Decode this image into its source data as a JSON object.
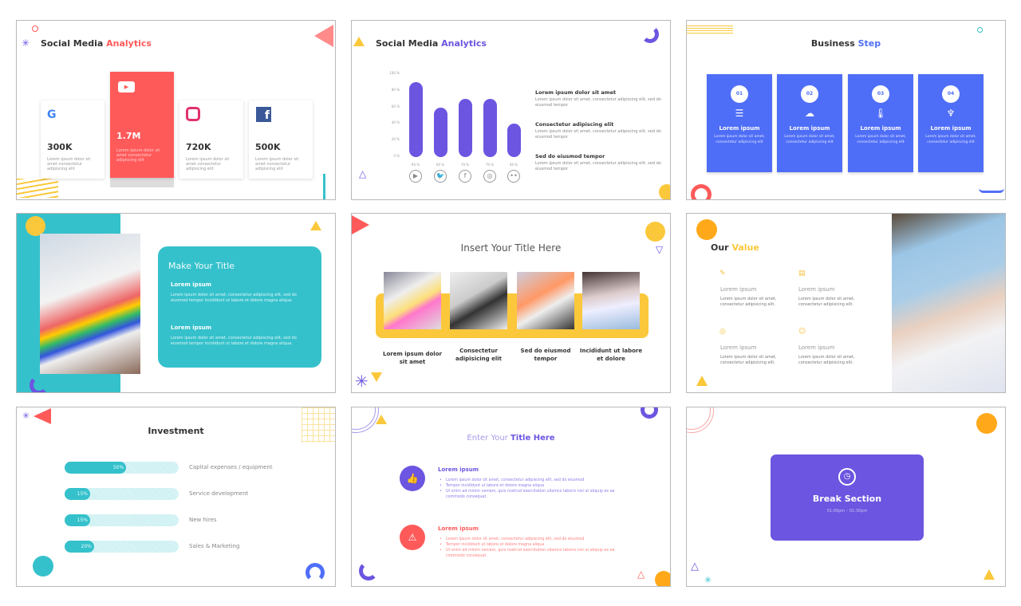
{
  "colors": {
    "red": "#ff5a5a",
    "purple": "#6c55e0",
    "blue": "#4f6ef7",
    "teal": "#35c1cb",
    "yellow": "#fbc83b",
    "orange": "#ffa91a"
  },
  "slides": [
    {
      "title_dark": "Social Media",
      "title_accent": "Analytics",
      "cards": [
        {
          "icon": "google-icon",
          "value": "300K",
          "desc": "Lorem ipsum dolor sit amet consectetur adipiscing elit"
        },
        {
          "icon": "youtube-icon",
          "value": "1.7M",
          "desc": "Lorem ipsum dolor sit amet consectetur adipiscing elit"
        },
        {
          "icon": "instagram-icon",
          "value": "720K",
          "desc": "Lorem ipsum dolor sit amet consectetur adipiscing elit"
        },
        {
          "icon": "facebook-icon",
          "value": "500K",
          "desc": "Lorem ipsum dolor sit amet consectetur adipiscing elit"
        }
      ]
    },
    {
      "title_dark": "Social Media",
      "title_accent": "Analytics",
      "points": [
        {
          "heading": "Lorem ipsum dolor sit amet",
          "desc": "Lorem ipsum dolor sit amet, consectetur adipiscing elit, sed do eiusmod tempor"
        },
        {
          "heading": "Consectetur adipiscing elit",
          "desc": "Lorem ipsum dolor sit amet, consectetur adipiscing elit, sed do eiusmod tempor"
        },
        {
          "heading": "Sed do eiusmod tempor",
          "desc": "Lorem ipsum dolor sit amet, consectetur adipiscing elit, sed do eiusmod tempor"
        }
      ]
    },
    {
      "title_dark": "Business",
      "title_accent": "Step",
      "steps": [
        {
          "num": "01",
          "icon": "server-icon",
          "heading": "Lorem ipsum",
          "desc": "Lorem ipsum dolor sit amet, consectetur adipiscing elit"
        },
        {
          "num": "02",
          "icon": "cloud-network-icon",
          "heading": "Lorem ipsum",
          "desc": "Lorem ipsum dolor sit amet, consectetur adipiscing elit"
        },
        {
          "num": "03",
          "icon": "thermometer-settings-icon",
          "heading": "Lorem ipsum",
          "desc": "Lorem ipsum dolor sit amet, consectetur adipiscing elit"
        },
        {
          "num": "04",
          "icon": "idea-bulbs-icon",
          "heading": "Lorem ipsum",
          "desc": "Lorem ipsum dolor sit amet, consectetur adipiscing elit"
        }
      ]
    },
    {
      "title": "Make Your Title",
      "blocks": [
        {
          "heading": "Lorem ipsum",
          "desc": "Lorem ipsum dolor sit amet, consectetur adipiscing elit, sed do eiusmod tempor incididunt ut labore et dolore magna aliqua."
        },
        {
          "heading": "Lorem ipsum",
          "desc": "Lorem ipsum dolor sit amet, consectetur adipiscing elit, sed do eiusmod tempor incididunt ut labore et dolore magna aliqua."
        }
      ]
    },
    {
      "title": "Insert Your Title Here",
      "captions": [
        "Lorem ipsum dolor sit amet",
        "Consectetur adipisicing elit",
        "Sed do eiusmod tempor",
        "Incididunt ut labore et dolore"
      ]
    },
    {
      "title_dark": "Our",
      "title_accent": "Value",
      "items": [
        {
          "icon": "document-edit-icon",
          "heading": "Lorem ipsum",
          "desc": "Lorem ipsum dolor sit amet, consectetur adipisicing elit."
        },
        {
          "icon": "layout-icon",
          "heading": "Lorem ipsum",
          "desc": "Lorem ipsum dolor sit amet, consectetur adipisicing elit."
        },
        {
          "icon": "target-icon",
          "heading": "Lorem ipsum",
          "desc": "Lorem ipsum dolor sit amet, consectetur adipisicing elit."
        },
        {
          "icon": "support-icon",
          "heading": "Lorem ipsum",
          "desc": "Lorem ipsum dolor sit amet, consectetur adipisicing elit."
        }
      ]
    },
    {
      "title": "Investment",
      "bars": [
        {
          "label": "Capital expenses / equipment",
          "value": 50,
          "text": "50%"
        },
        {
          "label": "Service development",
          "value": 15,
          "text": "15%"
        },
        {
          "label": "New hires",
          "value": 15,
          "text": "15%"
        },
        {
          "label": "Sales & Marketing",
          "value": 20,
          "text": "20%"
        }
      ]
    },
    {
      "title_light": "Enter Your",
      "title_bold": "Title Here",
      "sections": [
        {
          "icon": "thumbs-up-icon",
          "heading": "Lorem ipsum",
          "bullets": [
            "Lorem ipsum dolor sit amet, consectetur adipiscing elit, sed do eiusmod",
            "Tempor incididunt ut labore et dolore magna aliqua",
            "Ut enim ad minim veniam, quis nostrud exercitation ullamco laboris nisi ut aliquip ex ea commodo consequat."
          ]
        },
        {
          "icon": "warning-icon",
          "heading": "Lorem ipsum",
          "bullets": [
            "Lorem ipsum dolor sit amet, consectetur adipiscing elit, sed do eiusmod",
            "Tempor incididunt ut labore et dolore magna aliqua",
            "Ut enim ad minim veniam, quis nostrud exercitation ullamco laboris nisi ut aliquip ex ea commodo consequat."
          ]
        }
      ]
    },
    {
      "title": "Break Section",
      "time": "01:00pm – 01:30pm"
    }
  ],
  "chart_data": {
    "type": "bar",
    "categories": [
      "youtube",
      "twitter",
      "facebook",
      "instagram",
      "flickr"
    ],
    "values": [
      90,
      60,
      70,
      70,
      40
    ],
    "value_labels": [
      "90 %",
      "60 %",
      "70 %",
      "70 %",
      "40 %"
    ],
    "yticks": [
      "0 %",
      "20 %",
      "40 %",
      "60 %",
      "80 %",
      "100 %"
    ],
    "ylim": [
      0,
      100
    ],
    "grid": false
  }
}
